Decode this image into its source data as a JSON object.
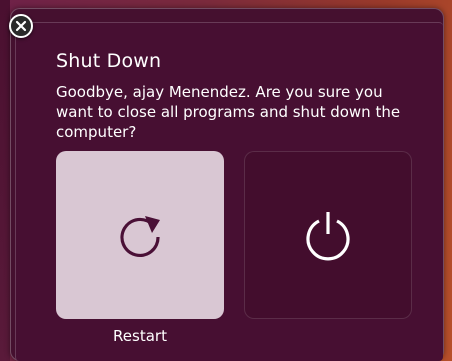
{
  "dialog": {
    "title": "Shut Down",
    "message": "Goodbye, ajay Menendez. Are you sure you want to close all programs and shut down the computer?",
    "options": [
      {
        "id": "restart",
        "label": "Restart",
        "icon": "restart-icon",
        "highlighted": true
      },
      {
        "id": "shutdown",
        "label": "",
        "icon": "power-icon",
        "highlighted": false
      }
    ]
  },
  "colors": {
    "dialog_bg": "#45102f",
    "highlight_bg": "#d9c7d3",
    "icon_dark": "#4a1036",
    "text": "#ffffff"
  }
}
